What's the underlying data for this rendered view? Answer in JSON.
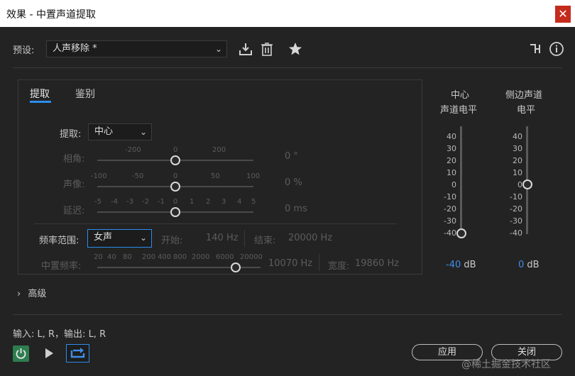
{
  "window": {
    "title": "效果 - 中置声道提取",
    "close_glyph": "✕"
  },
  "preset": {
    "label": "预设:",
    "value": "人声移除 *"
  },
  "tabs": [
    {
      "label": "提取"
    },
    {
      "label": "鉴别"
    }
  ],
  "extract": {
    "label": "提取:",
    "value": "中心"
  },
  "sliders": {
    "phase": {
      "label": "相角:",
      "ticks": [
        "-200",
        "0",
        "200"
      ],
      "value_text": "0 °"
    },
    "pan": {
      "label": "声像:",
      "ticks": [
        "-100",
        "-50",
        "0",
        "50",
        "100"
      ],
      "value_text": "0 %"
    },
    "delay": {
      "label": "延迟:",
      "ticks": [
        "-5",
        "-4",
        "-3",
        "-2",
        "-1",
        "0",
        "1",
        "2",
        "3",
        "4",
        "5"
      ],
      "value_text": "0 ms"
    }
  },
  "freq": {
    "label": "频率范围:",
    "value": "女声",
    "start_label": "开始:",
    "start_value": "140 Hz",
    "end_label": "结束:",
    "end_value": "20000 Hz"
  },
  "center_freq": {
    "label": "中置频率:",
    "ticks": [
      "20",
      "40",
      "80",
      "200",
      "400",
      "800",
      "2000",
      "6000",
      "20000"
    ],
    "value_text": "10070 Hz",
    "width_label": "宽度:",
    "width_value": "19860 Hz"
  },
  "meters": {
    "center": {
      "title1": "中心",
      "title2": "声道电平",
      "value": "-40",
      "unit": "dB"
    },
    "side": {
      "title1": "侧边声道",
      "title2": "电平",
      "value": "0",
      "unit": "dB"
    },
    "scale": [
      "40",
      "30",
      "20",
      "10",
      "0",
      "-10",
      "-20",
      "-30",
      "-40"
    ]
  },
  "advanced": {
    "label": "高级"
  },
  "io": {
    "text": "输入: L, R，输出: L, R"
  },
  "buttons": {
    "apply": "应用",
    "close": "关闭"
  },
  "watermark": "@稀土掘金技术社区",
  "colors": {
    "accent": "#2d8ceb",
    "power_green": "#2e7d4f",
    "value_blue": "#3d8ee8"
  }
}
